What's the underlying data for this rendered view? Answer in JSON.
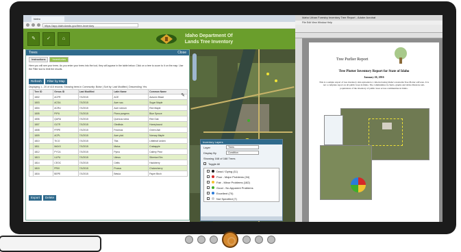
{
  "browser": {
    "tab_title": "Idaho",
    "url": "https://app.idaholands.gov/tree-inventory"
  },
  "app": {
    "agency_title": "Idaho Department Of Lands Tree Inventory",
    "buttons": [
      "✎",
      "✓",
      "⌂"
    ]
  },
  "panel": {
    "title": "Trees",
    "close_label": "Close",
    "tabs": [
      "Instructions",
      "Inventories"
    ],
    "instructions": "Here you will see your trees. As you enter your trees into the tool, they will appear in the table below. Click on a tree to zoom to it on the map. Use the Filter tool to limit the results.",
    "action_buttons": [
      "Refresh",
      "Filter by Map"
    ],
    "showing_text": "Displaying 1 - 20 of 415 records. Showing trees in Community: Boise | Sort by: Last Modified | Descending: Yes",
    "columns": [
      "",
      "Tree ID",
      "Genus ID",
      "Last Modified",
      "Latin Name",
      "Common Name"
    ],
    "rows": [
      [
        "",
        "1802",
        "ACFR",
        "7/1/2015",
        "ACE",
        "Autumn Blaze"
      ],
      [
        "",
        "1803",
        "ACSA",
        "7/1/2015",
        "Acer sac.",
        "Sugar Maple"
      ],
      [
        "",
        "1804",
        "ACRU",
        "7/1/2015",
        "Acer rubrum",
        "Red Maple"
      ],
      [
        "",
        "1805",
        "PIPU",
        "7/1/2015",
        "Picea pungens",
        "Blue Spruce"
      ],
      [
        "",
        "1806",
        "QURU",
        "7/1/2015",
        "Quercus rubra",
        "Red Oak"
      ],
      [
        "",
        "1807",
        "GLTR",
        "7/1/2015",
        "Gleditsia",
        "Honeylocust"
      ],
      [
        "",
        "1808",
        "FRPE",
        "7/1/2015",
        "Fraxinus",
        "Green Ash"
      ],
      [
        "",
        "1809",
        "ACPL",
        "7/1/2015",
        "Acer plat.",
        "Norway Maple"
      ],
      [
        "",
        "1810",
        "TICO",
        "7/1/2015",
        "Tilia",
        "Littleleaf Linden"
      ],
      [
        "",
        "1811",
        "MAXX",
        "7/1/2015",
        "Malus",
        "Crabapple"
      ],
      [
        "",
        "1812",
        "PYCA",
        "7/1/2015",
        "Pyrus",
        "Callery Pear"
      ],
      [
        "",
        "1813",
        "ULPU",
        "7/1/2015",
        "Ulmus",
        "Siberian Elm"
      ],
      [
        "",
        "1814",
        "CEOC",
        "7/1/2015",
        "Celtis",
        "Hackberry"
      ],
      [
        "",
        "1815",
        "PRVI",
        "7/1/2015",
        "Prunus",
        "Chokecherry"
      ],
      [
        "",
        "1816",
        "BEPE",
        "7/1/2015",
        "Betula",
        "Paper Birch"
      ]
    ],
    "footer_buttons": [
      "Export",
      "Delete"
    ]
  },
  "legend": {
    "title": "Inventory Layers",
    "label_1": "Layer",
    "value_1": "Trees",
    "label_2": "Display By",
    "value_2": "Condition",
    "showing": "Showing 168 of 168 Trees",
    "toggle_all": "Toggle All",
    "items": [
      {
        "label": "Dead / Dying (11)",
        "color": "#222222"
      },
      {
        "label": "Poor - Major Problems (34)",
        "color": "#d62828"
      },
      {
        "label": "Fair - Minor Problems (182)",
        "color": "#f2c230"
      },
      {
        "label": "Good - No Apparent Problems",
        "color": "#3fae2a"
      },
      {
        "label": "Excellent (70)",
        "color": "#2b7bd9"
      },
      {
        "label": "Not Specified (7)",
        "color": "#cccccc"
      }
    ]
  },
  "pdf": {
    "window_title": "Idaho Urban Forestry Inventory Tree Report - Adobe Acrobat",
    "menu": "File  Edit  View  Window  Help",
    "report_heading": "Tree Purlier Report",
    "title": "Tree Plotter Inventory Report for State of Idaho",
    "date": "January 26, 2016",
    "paragraph": "This is a sample export of tree inventory data uploaded or collected using Idaho's statewide Tree Plotter software. It is not a complete report on all public trees in Idaho. The communities in charts, graphs and tables illustrate sub-populations of the inventory of public trees across communities in Idaho."
  },
  "colors": {
    "brand_green": "#6a9e2c",
    "header_blue": "#2f6a8c",
    "row_alt": "#e3f0c8"
  }
}
